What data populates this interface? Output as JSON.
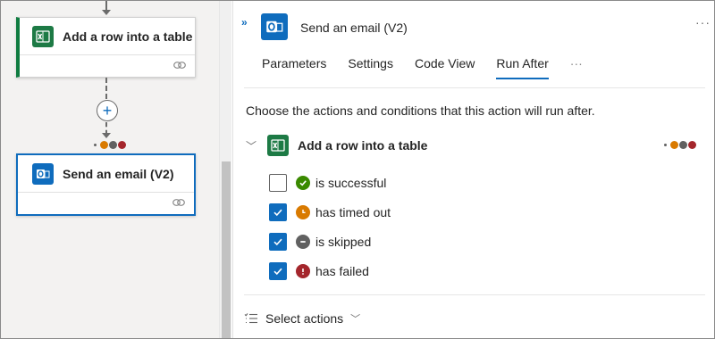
{
  "canvas": {
    "plus_symbol": "+",
    "excel_card": {
      "title": "Add a row into a table",
      "icon": "excel-icon",
      "accent": "#107c41"
    },
    "email_card": {
      "title": "Send an email (V2)",
      "icon": "outlook-icon",
      "accent": "#0f6cbd"
    }
  },
  "panel": {
    "collapse_glyph": "»",
    "title": "Send an email (V2)",
    "more_glyph": "···",
    "tabs": [
      {
        "label": "Parameters",
        "active": false
      },
      {
        "label": "Settings",
        "active": false
      },
      {
        "label": "Code View",
        "active": false
      },
      {
        "label": "Run After",
        "active": true
      }
    ],
    "tabs_more": "···",
    "description": "Choose the actions and conditions that this action will run after.",
    "group": {
      "title": "Add a row into a table",
      "chevron": "﹀"
    },
    "statuses": [
      {
        "label": "is successful",
        "checked": false,
        "color": "#3a8a00",
        "icon": "checkmark-circle-icon"
      },
      {
        "label": "has timed out",
        "checked": true,
        "color": "#d97a00",
        "icon": "clock-icon"
      },
      {
        "label": "is skipped",
        "checked": true,
        "color": "#616161",
        "icon": "skip-minus-icon"
      },
      {
        "label": "has failed",
        "checked": true,
        "color": "#a4262c",
        "icon": "error-icon"
      }
    ],
    "select_actions": {
      "label": "Select actions",
      "chevron": "﹀"
    }
  },
  "colors": {
    "success": "#3a8a00",
    "timeout": "#d97a00",
    "skipped": "#616161",
    "failed": "#a4262c",
    "accent": "#0f6cbd"
  }
}
